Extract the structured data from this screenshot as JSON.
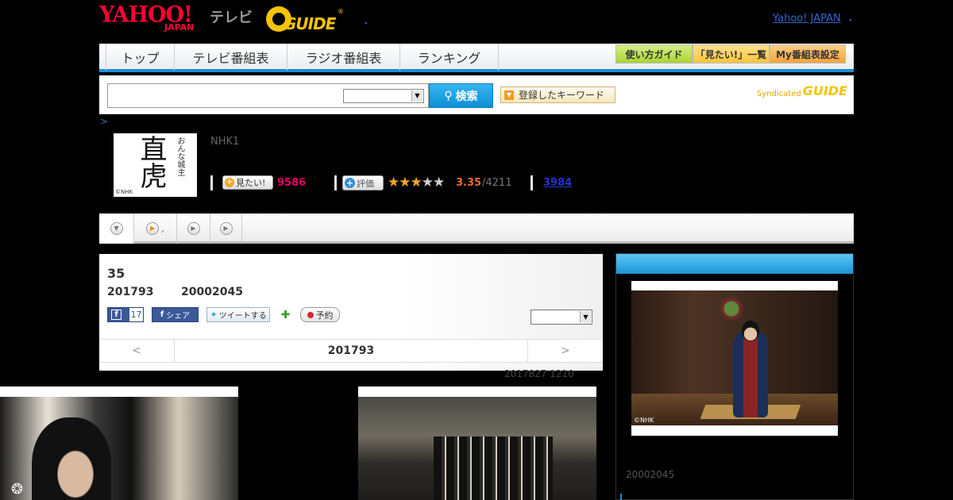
{
  "header": {
    "yahoo_logo": "YAHOO!",
    "yahoo_logo_sub": "JAPAN",
    "tv_label": "テレビ",
    "gguide_logo": "GUIDE",
    "gguide_reg": "®",
    "yahoo_japan_link": "Yahoo! JAPAN"
  },
  "nav": {
    "tabs": [
      {
        "label": "トップ"
      },
      {
        "label": "テレビ番組表"
      },
      {
        "label": "ラジオ番組表"
      },
      {
        "label": "ランキング"
      }
    ],
    "buttons": [
      {
        "label": "使い方ガイド"
      },
      {
        "label": "「見たい!」一覧"
      },
      {
        "label": "My番組表設定"
      }
    ]
  },
  "search": {
    "input_value": "",
    "select_value": "",
    "button_label": "検索",
    "keyword_button_label": "登録したキーワード",
    "syndicated_label": "Syndicated",
    "syndicated_logo": "GUIDE"
  },
  "breadcrumb": ">",
  "program": {
    "thumb_title": "直虎",
    "thumb_subtitle": "おんな城主",
    "thumb_credit": "©NHK",
    "channel": "NHK1",
    "mitai_label": "見たい!",
    "mitai_count": "9586",
    "hyoka_label": "評価",
    "stars_filled": 3,
    "stars_total": 5,
    "rating": "3.35",
    "rating_count": "/4211",
    "review_count": "3984"
  },
  "subtabs": [
    "",
    ",",
    "",
    ""
  ],
  "episode": {
    "number": "35",
    "date": "201793",
    "viewer_rating": "20002045",
    "like_label": "f",
    "like_count": "17",
    "share_label": "シェア",
    "tweet_label": "ツイートする",
    "reserve_label": "予約",
    "select_value": "",
    "nav_prev": "<",
    "nav_current": "201793",
    "nav_next": ">",
    "meta": "2017827  1210"
  },
  "side": {
    "photo_credit": "©NHK",
    "rating_text": "20002045"
  },
  "colors": {
    "accent_blue": "#1f8bd8",
    "mitai_pink": "#e40062",
    "rating_orange": "#e76a2c",
    "star_gold": "#f5a623",
    "link_blue": "#3366cc"
  }
}
